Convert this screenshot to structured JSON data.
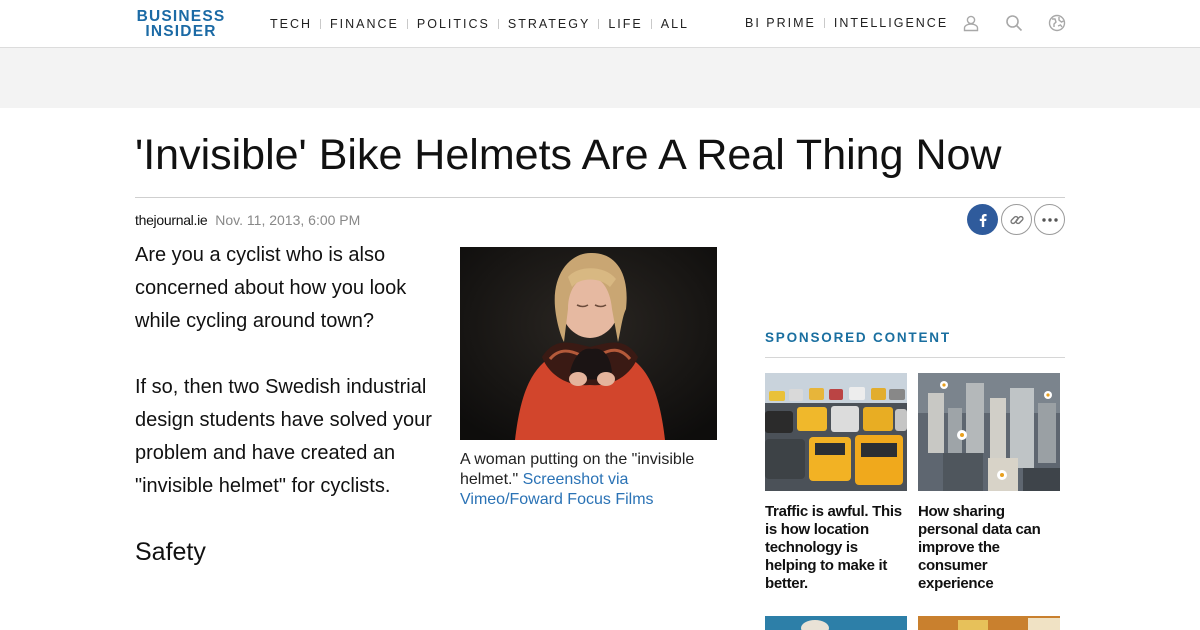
{
  "header": {
    "logo_line1": "BUSINESS",
    "logo_line2": "INSIDER",
    "nav": [
      {
        "label": "TECH"
      },
      {
        "label": "FINANCE"
      },
      {
        "label": "POLITICS"
      },
      {
        "label": "STRATEGY"
      },
      {
        "label": "LIFE"
      },
      {
        "label": "ALL"
      }
    ],
    "right_nav": [
      {
        "label": "BI PRIME"
      },
      {
        "label": "INTELLIGENCE"
      }
    ],
    "icons": [
      "user-icon",
      "search-icon",
      "globe-icon"
    ]
  },
  "article": {
    "headline": "'Invisible' Bike Helmets Are A Real Thing Now",
    "source": "thejournal.ie",
    "date": "Nov. 11, 2013, 6:00 PM",
    "paragraphs": [
      "Are you a cyclist who is also concerned about how you look while cycling around town?",
      "If so, then two Swedish industrial design students have solved your problem and have created an \"invisible helmet\" for cyclists."
    ],
    "subheading": "Safety",
    "image": {
      "caption": "A woman putting on the \"invisible helmet.\" ",
      "credit": "Screenshot via Vimeo/Foward Focus Films"
    }
  },
  "share": {
    "icons": [
      "facebook-icon",
      "link-icon",
      "more-icon"
    ]
  },
  "sponsored": {
    "title": "SPONSORED CONTENT",
    "cards": [
      {
        "title": "Traffic is awful. This is how location technology is helping to make it better."
      },
      {
        "title": "How sharing personal data can improve the consumer experience"
      }
    ]
  },
  "colors": {
    "brand": "#1b6aa5",
    "link": "#2a72b5",
    "sponsored": "#1a6fa0",
    "facebook": "#2f5b9c"
  }
}
